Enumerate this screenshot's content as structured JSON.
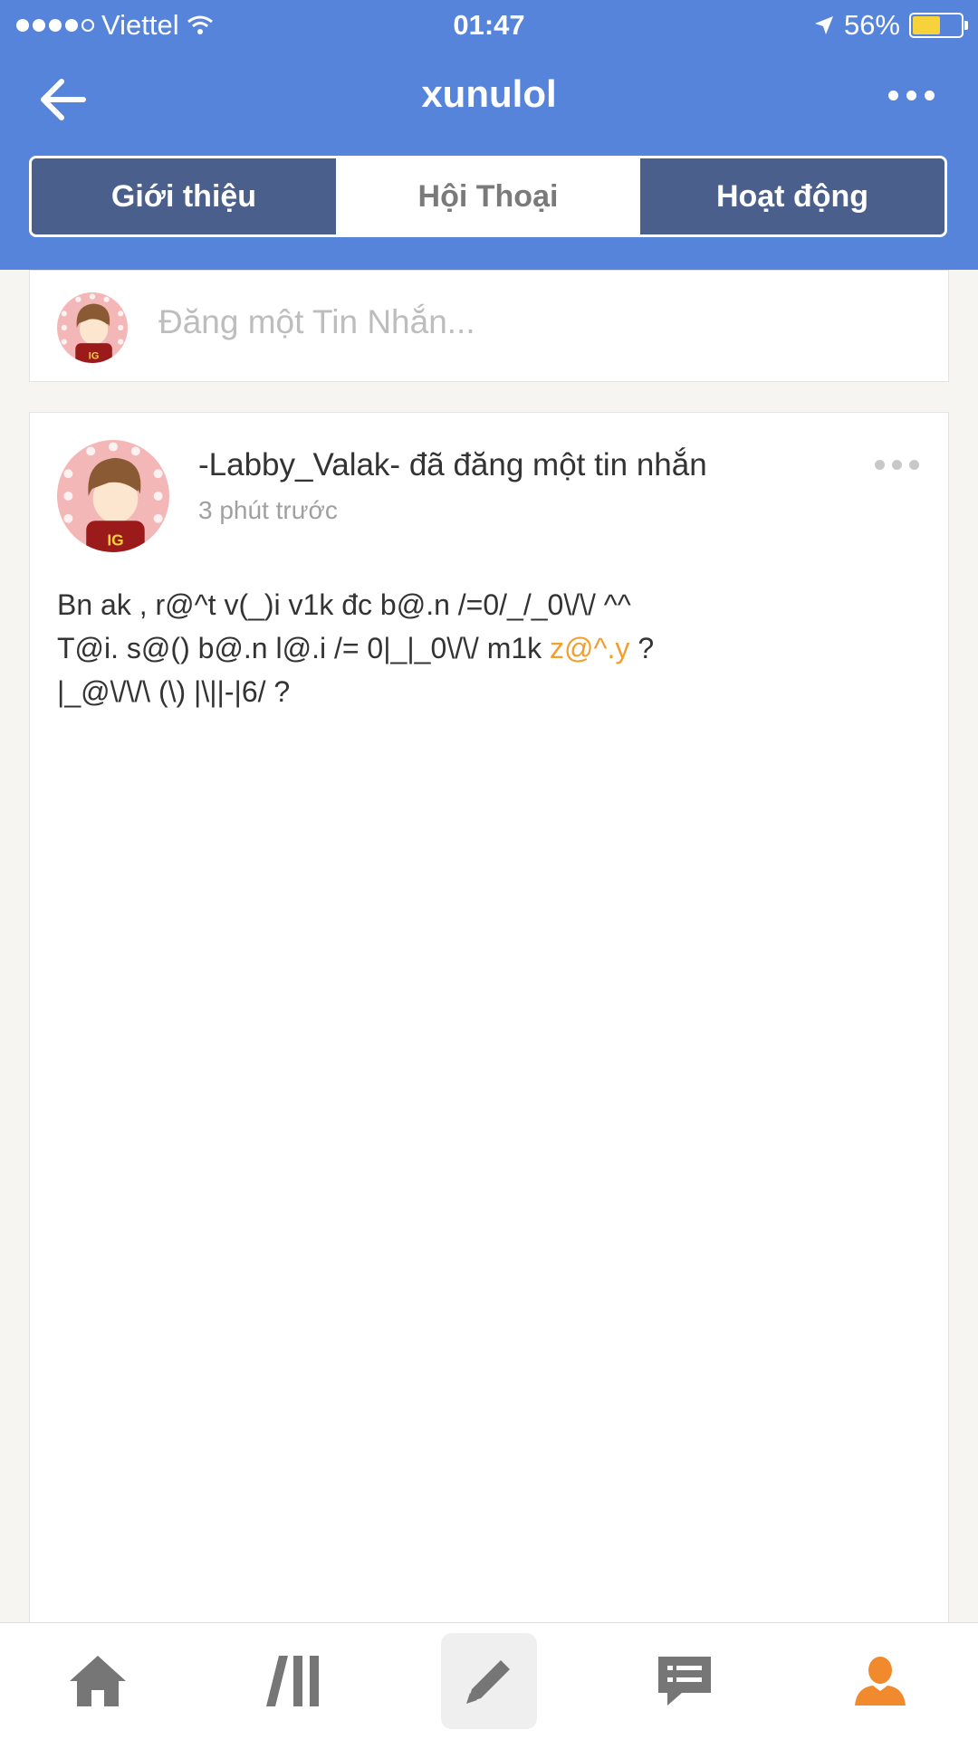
{
  "status_bar": {
    "carrier": "Viettel",
    "time": "01:47",
    "battery": "56%",
    "battery_level": 0.56
  },
  "header": {
    "title": "xunulol"
  },
  "tabs": [
    {
      "label": "Giới thiệu",
      "active": false
    },
    {
      "label": "Hội Thoại",
      "active": true
    },
    {
      "label": "Hoạt động",
      "active": false
    }
  ],
  "compose": {
    "placeholder": "Đăng một Tin Nhắn..."
  },
  "post": {
    "author_line": "-Labby_Valak- đã đăng một tin nhắn",
    "time": "3 phút trước",
    "line1": "Bn ak , r@^t v(_)i v1k đc b@.n /=0/_/_0\\/\\/ ^^",
    "line2_a": "T@i. s@() b@.n l@.i /= 0|_|_0\\/\\/ m1k ",
    "line2_hl": "z@^.y",
    "line2_b": " ?",
    "line3": "|_@\\/\\/\\ (\\) |\\||-|6/ ?"
  },
  "colors": {
    "header": "#5684db",
    "tab_inactive": "#4b5f8d",
    "highlight": "#f0a030",
    "profile_active": "#f08a2c"
  },
  "bottom_nav": [
    {
      "icon": "home-icon"
    },
    {
      "icon": "feed-icon"
    },
    {
      "icon": "pencil-icon"
    },
    {
      "icon": "chat-icon"
    },
    {
      "icon": "profile-icon"
    }
  ]
}
